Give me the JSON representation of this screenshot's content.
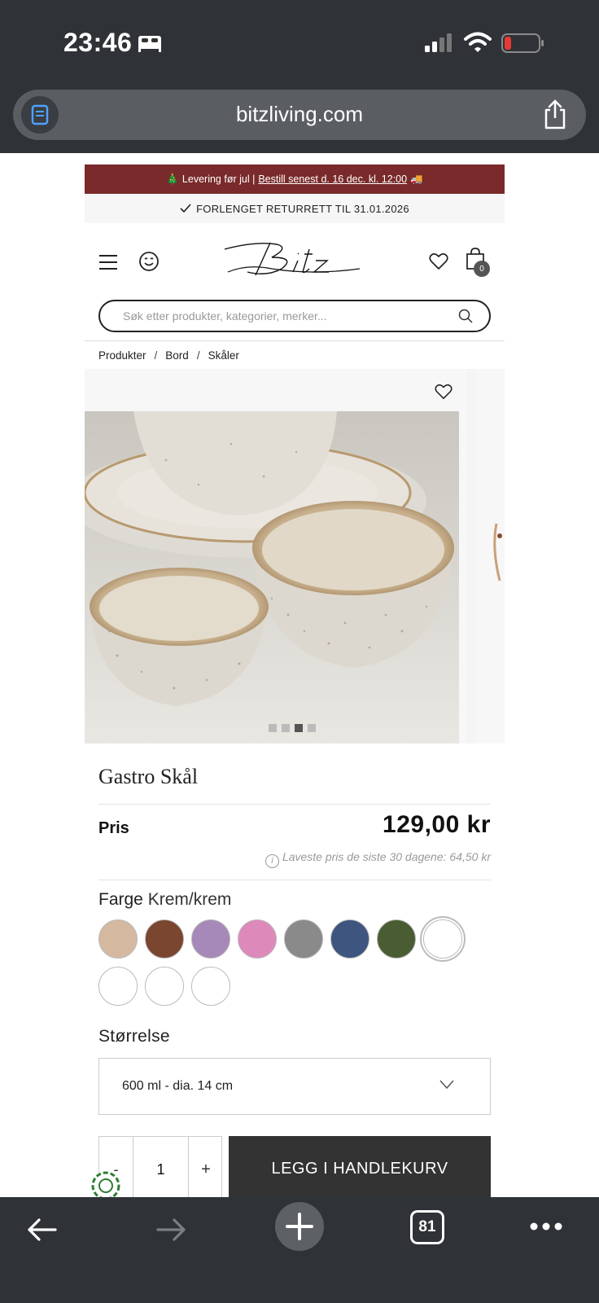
{
  "status_bar": {
    "time": "23:46"
  },
  "browser": {
    "url": "bitzliving.com",
    "open_tabs": "81"
  },
  "site": {
    "promo_banner": {
      "emoji_tree": "🎄",
      "lead_text": "Levering før jul |",
      "link_text": "Bestill senest d. 16 dec. kl. 12:00",
      "emoji_truck": "🚚"
    },
    "return_banner": "FORLENGET RETURRETT TIL 31.01.2026",
    "logo_text": "Bitz",
    "cart_count": "0",
    "search": {
      "placeholder": "Søk etter produkter, kategorier, merker..."
    },
    "breadcrumb": [
      {
        "label": "Produkter"
      },
      {
        "label": "Bord"
      },
      {
        "label": "Skåler"
      }
    ]
  },
  "gallery": {
    "active_image": 3,
    "image_count": 4
  },
  "product": {
    "title": "Gastro Skål",
    "price_label": "Pris",
    "price": "129,00 kr",
    "lowest_price_note": "Laveste pris de siste 30 dagene: 64,50 kr",
    "color_label": "Farge",
    "color_value": "Krem/krem",
    "swatches": [
      "#d4b8a0",
      "#7a4630",
      "#a689b8",
      "#dd8abb",
      "#8a8a8a",
      "#3d557f",
      "#4a5d32",
      "#ffffff",
      "#ffffff",
      "#ffffff",
      "#ffffff"
    ],
    "selected_swatch_index": 7,
    "size_label": "Størrelse",
    "size_value": "600 ml - dia. 14 cm",
    "quantity": "1",
    "qty_minus": "-",
    "qty_plus": "+",
    "add_to_cart": "LEGG I HANDLEKURV"
  }
}
